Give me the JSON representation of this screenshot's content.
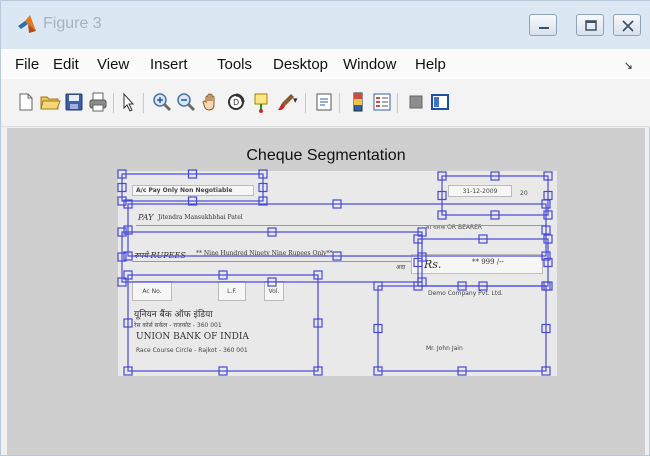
{
  "window": {
    "title": "Figure 3",
    "accent_color": "#4848d8"
  },
  "menu": {
    "items": [
      "File",
      "Edit",
      "View",
      "Insert",
      "Tools",
      "Desktop",
      "Window",
      "Help"
    ]
  },
  "toolbar": {
    "icons": [
      "new-file-icon",
      "open-folder-icon",
      "save-icon",
      "print-icon",
      "pointer-icon",
      "zoom-in-icon",
      "zoom-out-icon",
      "pan-hand-icon",
      "rotate-3d-icon",
      "data-cursor-icon",
      "brush-icon",
      "link-plot-icon",
      "insert-colorbar-icon",
      "insert-legend-icon",
      "hide-plot-tools-icon",
      "show-plot-tools-icon"
    ]
  },
  "figure": {
    "title": "Cheque Segmentation"
  },
  "cheque": {
    "crossing": "A/c Pay Only  Non Negotiable",
    "date": "31-12-2009",
    "date_suffix": "20",
    "pay_label": "PAY",
    "payee": "Jitendra Mansukhbhai Patel",
    "bearer_text": "या धारक OR BEARER",
    "rupees_label": "रुपये RUPEES",
    "amount_words": "** Nine Hundred Ninety Nine Rupees Only**",
    "rs_prefix": "अदा",
    "rs_label": "Rs.",
    "amount_figures": "** 999 /--",
    "account_label": "Ac No.",
    "lf_label": "L.F.",
    "vol_label": "Vol.",
    "company": "Demo Company Pvt. Ltd.",
    "bank_hindi": "यूनियन बैंक ऑफ इंडिया",
    "branch_hindi": "रेस कोर्स सर्कल - राजकोट - 360 001",
    "bank_name": "UNION BANK OF INDIA",
    "branch": "Race Course Circle - Rajkot - 360 001",
    "signatory": "Mr. John Jain"
  }
}
